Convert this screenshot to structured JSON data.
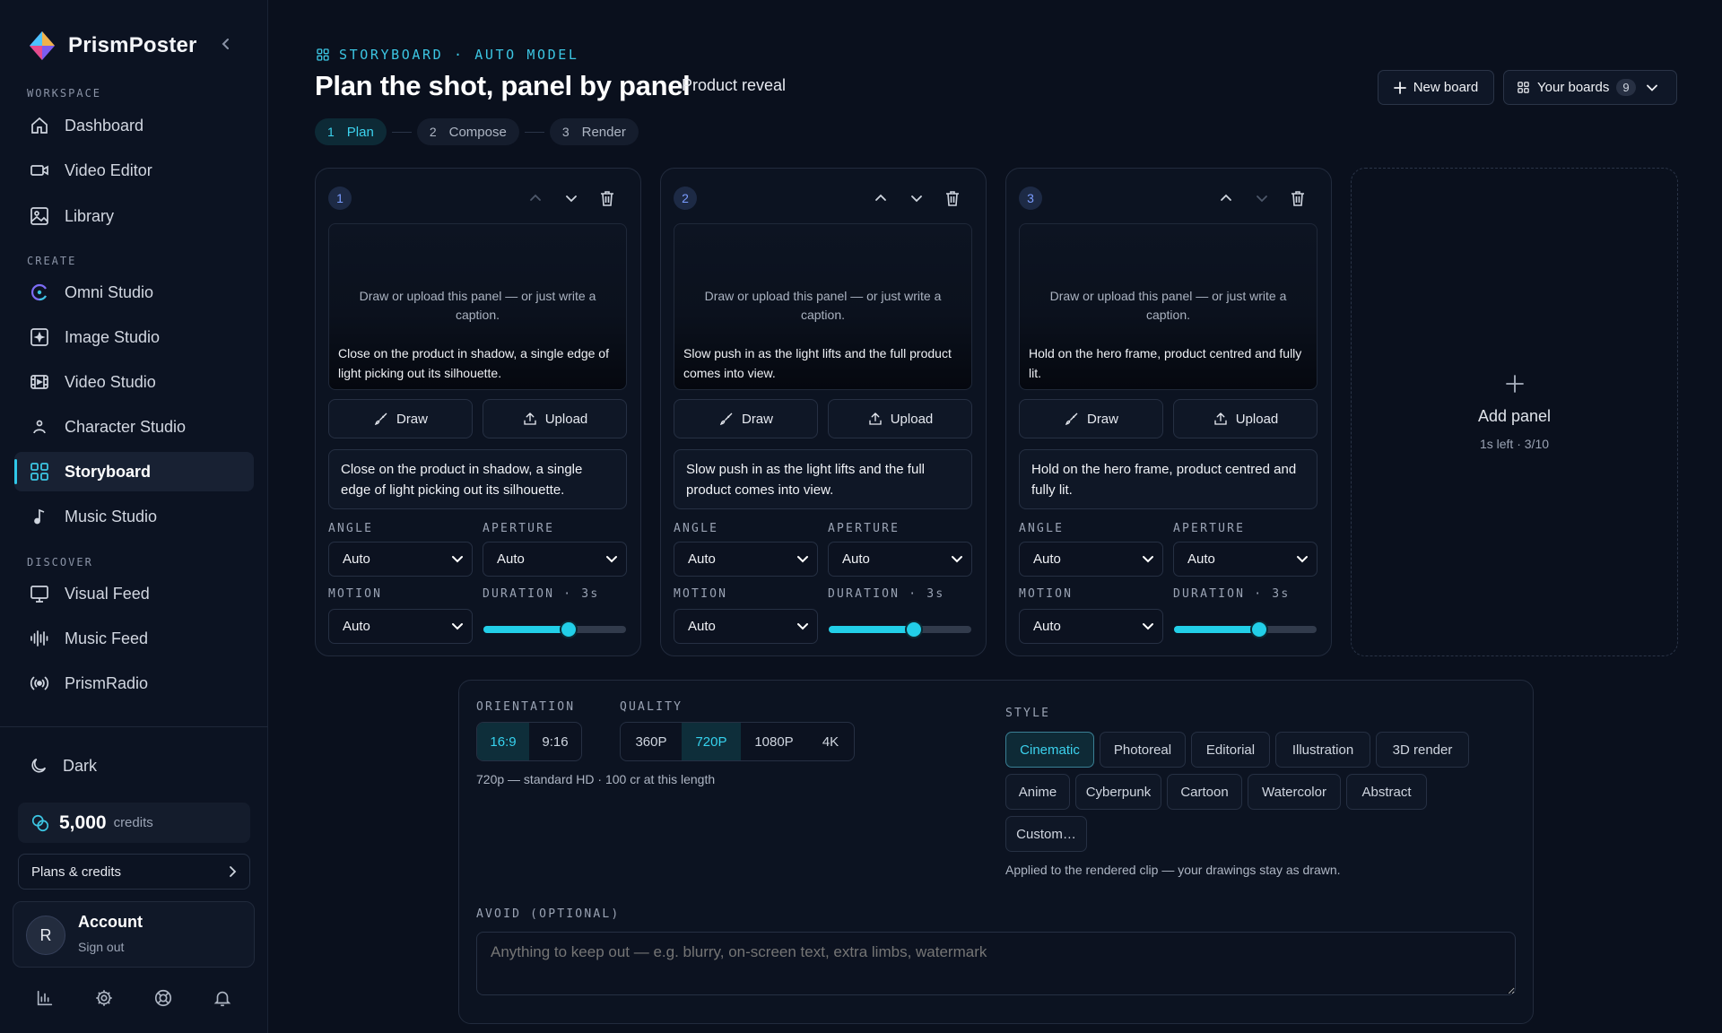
{
  "app": {
    "name": "PrismPoster"
  },
  "sidebar": {
    "sections": {
      "workspace": "WORKSPACE",
      "create": "CREATE",
      "discover": "DISCOVER"
    },
    "items": [
      {
        "label": "Dashboard",
        "icon": "home-icon"
      },
      {
        "label": "Video Editor",
        "icon": "video-camera-icon"
      },
      {
        "label": "Library",
        "icon": "image-icon"
      },
      {
        "label": "Omni Studio",
        "icon": "omni-icon"
      },
      {
        "label": "Image Studio",
        "icon": "image-studio-icon"
      },
      {
        "label": "Video Studio",
        "icon": "film-icon"
      },
      {
        "label": "Character Studio",
        "icon": "person-icon"
      },
      {
        "label": "Storyboard",
        "icon": "grid-icon",
        "active": true
      },
      {
        "label": "Music Studio",
        "icon": "music-note-icon"
      },
      {
        "label": "Visual Feed",
        "icon": "monitor-icon"
      },
      {
        "label": "Music Feed",
        "icon": "waveform-icon"
      },
      {
        "label": "PrismRadio",
        "icon": "radio-icon"
      }
    ],
    "theme_label": "Dark",
    "credits": {
      "value": "5,000",
      "label": "credits"
    },
    "plans_label": "Plans & credits",
    "account": {
      "initial": "R",
      "name": "Account",
      "action": "Sign out"
    }
  },
  "header": {
    "eyebrow": "STORYBOARD · AUTO MODEL",
    "title": "Plan the shot, panel by panel",
    "subtitle": "Product reveal",
    "new_board": "New board",
    "your_boards": "Your boards",
    "boards_count": "9"
  },
  "steps": [
    {
      "n": "1",
      "label": "Plan",
      "active": true
    },
    {
      "n": "2",
      "label": "Compose"
    },
    {
      "n": "3",
      "label": "Render"
    }
  ],
  "panel_labels": {
    "hint": "Draw or upload this panel — or just write a caption.",
    "draw": "Draw",
    "upload": "Upload",
    "angle": "ANGLE",
    "aperture": "APERTURE",
    "motion": "MOTION",
    "duration": "DURATION · 3s"
  },
  "panels": [
    {
      "num": "1",
      "canvas_caption": "Close on the product in shadow, a single edge of light picking out its silhouette.",
      "caption": "Close on the product in shadow, a single edge of light picking out its silhouette.",
      "angle": "Auto",
      "aperture": "Auto",
      "motion": "Auto",
      "duration_fraction": 0.6
    },
    {
      "num": "2",
      "canvas_caption": "Slow push in as the light lifts and the full product comes into view.",
      "caption": "Slow push in as the light lifts and the full product comes into view.",
      "angle": "Auto",
      "aperture": "Auto",
      "motion": "Auto",
      "duration_fraction": 0.6
    },
    {
      "num": "3",
      "canvas_caption": "Hold on the hero frame, product centred and fully lit.",
      "caption": "Hold on the hero frame, product centred and fully lit.",
      "angle": "Auto",
      "aperture": "Auto",
      "motion": "Auto",
      "duration_fraction": 0.6
    }
  ],
  "add_panel": {
    "label": "Add panel",
    "sub": "1s left · 3/10"
  },
  "settings": {
    "orientation_label": "ORIENTATION",
    "orientations": [
      "16:9",
      "9:16"
    ],
    "orientation_selected": "16:9",
    "quality_label": "QUALITY",
    "qualities": [
      "360P",
      "720P",
      "1080P",
      "4K"
    ],
    "quality_selected": "720P",
    "quality_hint": "720p — standard HD · 100 cr at this length",
    "style_label": "STYLE",
    "styles": [
      "Cinematic",
      "Photoreal",
      "Editorial",
      "Illustration",
      "3D render",
      "Anime",
      "Cyberpunk",
      "Cartoon",
      "Watercolor",
      "Abstract",
      "Custom…"
    ],
    "style_selected": "Cinematic",
    "style_hint": "Applied to the rendered clip — your drawings stay as drawn.",
    "avoid_label": "AVOID (OPTIONAL)",
    "avoid_placeholder": "Anything to keep out — e.g. blurry, on-screen text, extra limbs, watermark"
  },
  "colors": {
    "accent": "#22cfe8",
    "background": "#0a101d",
    "sidebar": "#0c1322",
    "panel_number": "#7a9cff"
  }
}
